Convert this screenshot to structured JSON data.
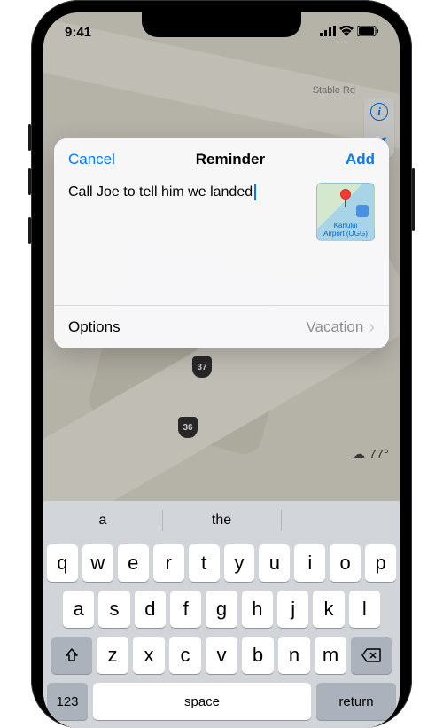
{
  "status": {
    "time": "9:41",
    "signal": "▪▪▪▪",
    "wifi": "wifi",
    "battery": "■"
  },
  "map": {
    "street_label": "Stable Rd",
    "route_shields": [
      "37",
      "36"
    ],
    "info_label": "i"
  },
  "weather": {
    "icon": "☁",
    "temp": "77°"
  },
  "modal": {
    "cancel": "Cancel",
    "title": "Reminder",
    "add": "Add",
    "text": "Call Joe to tell him we landed",
    "location_thumb": {
      "label_line1": "Kahului",
      "label_line2": "Airport (OGG)"
    },
    "options_label": "Options",
    "options_value": "Vacation"
  },
  "keyboard": {
    "suggestions": [
      "a",
      "the",
      ""
    ],
    "row1": [
      "q",
      "w",
      "e",
      "r",
      "t",
      "y",
      "u",
      "i",
      "o",
      "p"
    ],
    "row2": [
      "a",
      "s",
      "d",
      "f",
      "g",
      "h",
      "j",
      "k",
      "l"
    ],
    "row3": [
      "z",
      "x",
      "c",
      "v",
      "b",
      "n",
      "m"
    ],
    "num_key": "123",
    "space": "space",
    "return": "return"
  }
}
